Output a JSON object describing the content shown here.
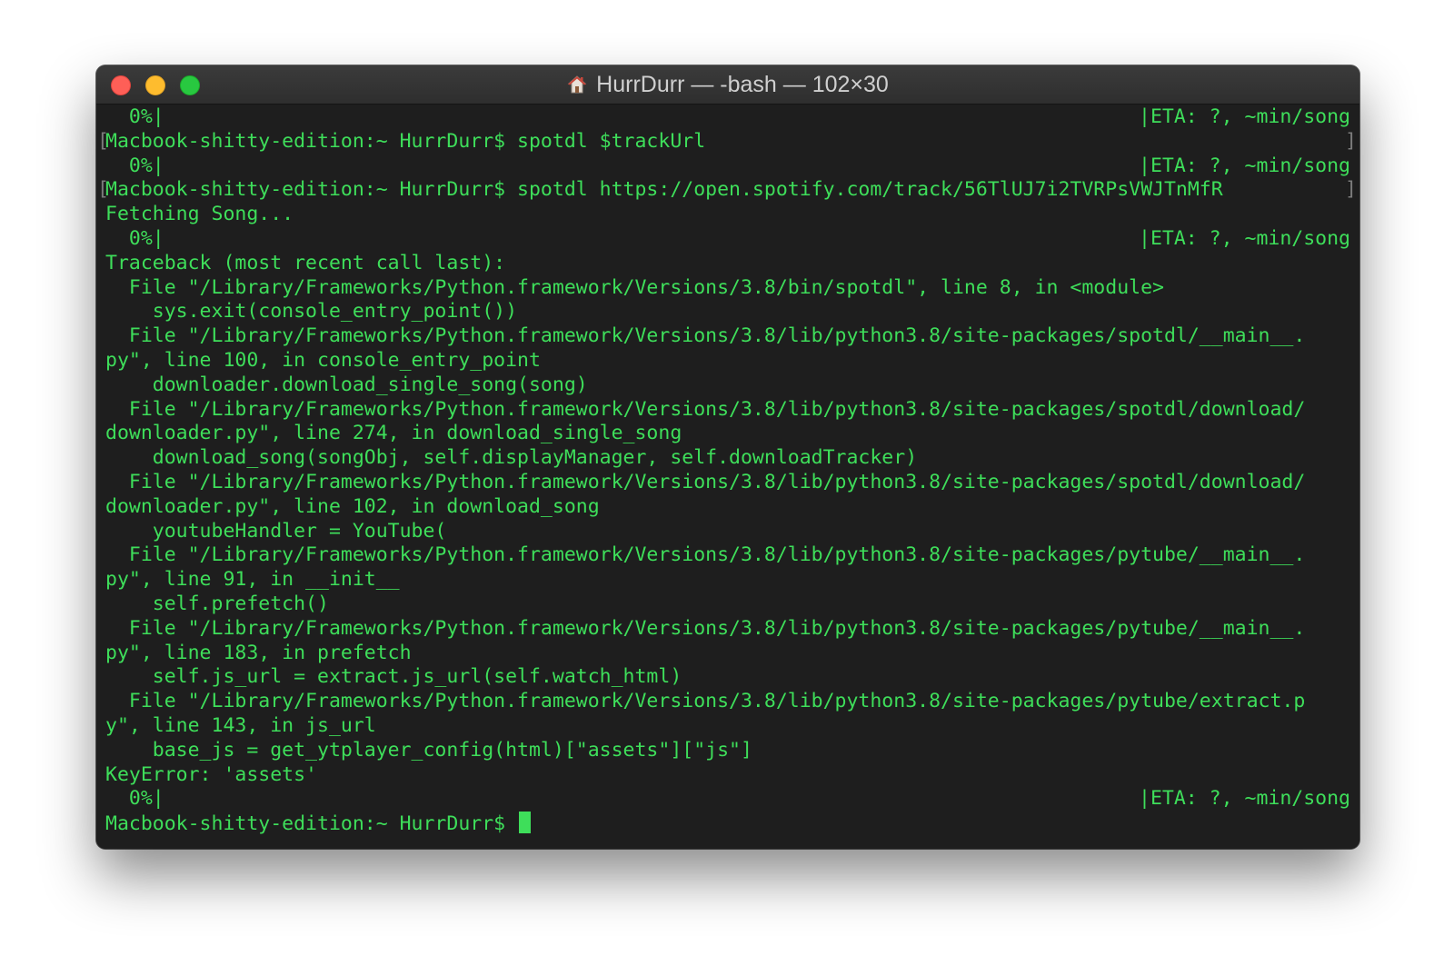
{
  "window": {
    "title": "HurrDurr — -bash — 102×30",
    "title_icon": "home-icon",
    "traffic_lights": [
      "close",
      "minimize",
      "zoom"
    ]
  },
  "colors": {
    "terminal_bg": "#1e1e1e",
    "text": "#3ede5a",
    "titlebar": "#333333",
    "close": "#fe5f57",
    "minimize": "#febc2e",
    "zoom": "#28c840"
  },
  "terminal": {
    "lines": [
      {
        "text": "  0%|",
        "eta": "|ETA: ?, ~min/song"
      },
      {
        "text": "Macbook-shitty-edition:~ HurrDurr$ spotdl $trackUrl",
        "marked": true
      },
      {
        "text": "  0%|",
        "eta": "|ETA: ?, ~min/song"
      },
      {
        "text": "Macbook-shitty-edition:~ HurrDurr$ spotdl https://open.spotify.com/track/56TlUJ7i2TVRPsVWJTnMfR",
        "marked": true
      },
      {
        "text": "Fetching Song..."
      },
      {
        "text": "  0%|",
        "eta": "|ETA: ?, ~min/song"
      },
      {
        "text": "Traceback (most recent call last):"
      },
      {
        "text": "  File \"/Library/Frameworks/Python.framework/Versions/3.8/bin/spotdl\", line 8, in <module>"
      },
      {
        "text": "    sys.exit(console_entry_point())"
      },
      {
        "text": "  File \"/Library/Frameworks/Python.framework/Versions/3.8/lib/python3.8/site-packages/spotdl/__main__."
      },
      {
        "text": "py\", line 100, in console_entry_point"
      },
      {
        "text": "    downloader.download_single_song(song)"
      },
      {
        "text": "  File \"/Library/Frameworks/Python.framework/Versions/3.8/lib/python3.8/site-packages/spotdl/download/"
      },
      {
        "text": "downloader.py\", line 274, in download_single_song"
      },
      {
        "text": "    download_song(songObj, self.displayManager, self.downloadTracker)"
      },
      {
        "text": "  File \"/Library/Frameworks/Python.framework/Versions/3.8/lib/python3.8/site-packages/spotdl/download/"
      },
      {
        "text": "downloader.py\", line 102, in download_song"
      },
      {
        "text": "    youtubeHandler = YouTube("
      },
      {
        "text": "  File \"/Library/Frameworks/Python.framework/Versions/3.8/lib/python3.8/site-packages/pytube/__main__."
      },
      {
        "text": "py\", line 91, in __init__"
      },
      {
        "text": "    self.prefetch()"
      },
      {
        "text": "  File \"/Library/Frameworks/Python.framework/Versions/3.8/lib/python3.8/site-packages/pytube/__main__."
      },
      {
        "text": "py\", line 183, in prefetch"
      },
      {
        "text": "    self.js_url = extract.js_url(self.watch_html)"
      },
      {
        "text": "  File \"/Library/Frameworks/Python.framework/Versions/3.8/lib/python3.8/site-packages/pytube/extract.p"
      },
      {
        "text": "y\", line 143, in js_url"
      },
      {
        "text": "    base_js = get_ytplayer_config(html)[\"assets\"][\"js\"]"
      },
      {
        "text": "KeyError: 'assets'"
      },
      {
        "text": "  0%|",
        "eta": "|ETA: ?, ~min/song"
      },
      {
        "text": "Macbook-shitty-edition:~ HurrDurr$ ",
        "cursor": true
      }
    ]
  }
}
